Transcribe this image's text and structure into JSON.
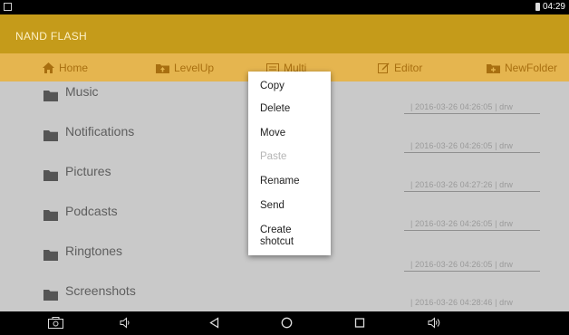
{
  "status_bar": {
    "time": "04:29"
  },
  "app": {
    "title": "NAND FLASH"
  },
  "toolbar": {
    "home": "Home",
    "levelup": "LevelUp",
    "multi": "Multi",
    "editor": "Editor",
    "newfolder": "NewFolder"
  },
  "files": [
    {
      "name": "Music",
      "meta": "| 2016-03-26 04:26:05 | drw"
    },
    {
      "name": "Notifications",
      "meta": "| 2016-03-26 04:26:05 | drw"
    },
    {
      "name": "Pictures",
      "meta": "| 2016-03-26 04:27:26 | drw"
    },
    {
      "name": "Podcasts",
      "meta": "| 2016-03-26 04:26:05 | drw"
    },
    {
      "name": "Ringtones",
      "meta": "| 2016-03-26 04:26:05 | drw"
    },
    {
      "name": "Screenshots",
      "meta": "| 2016-03-26 04:28:46 | drw"
    }
  ],
  "context_menu": {
    "copy": "Copy",
    "delete": "Delete",
    "move": "Move",
    "paste": "Paste",
    "rename": "Rename",
    "send": "Send",
    "create_shortcut_line1": "Create",
    "create_shortcut_line2": "shotcut"
  },
  "colors": {
    "appbar": "#c59b1a",
    "toolbar": "#e5b54f",
    "toolbar_text": "#a86f10",
    "list_bg": "#c9c9c9"
  }
}
